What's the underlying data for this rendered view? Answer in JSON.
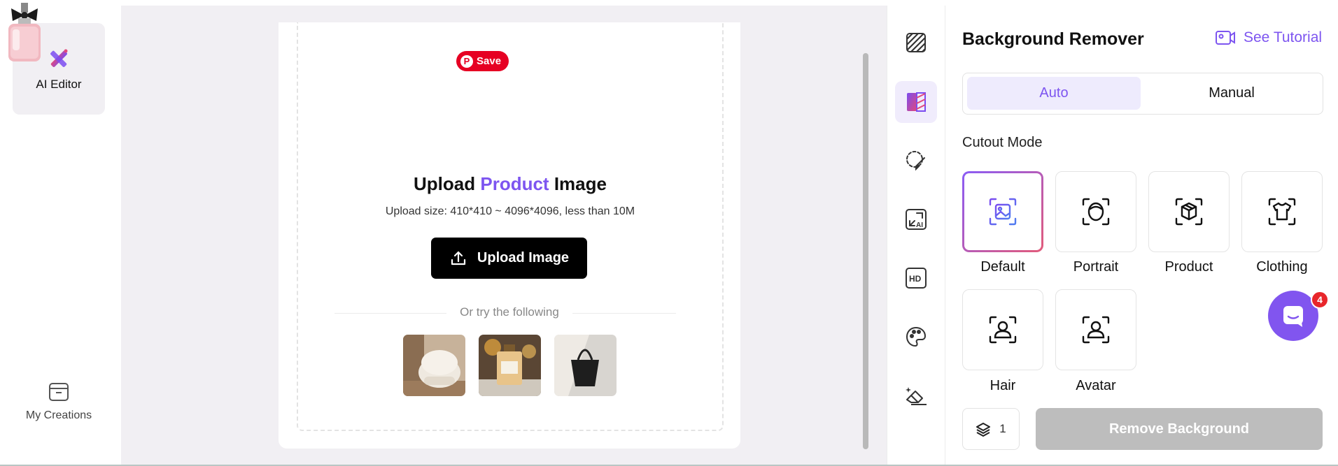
{
  "left_nav": {
    "ai_editor_label": "AI Editor",
    "my_creations_label": "My Creations"
  },
  "canvas": {
    "pinterest_save": "Save",
    "title_part1": "Upload ",
    "title_highlight": "Product",
    "title_part2": " Image",
    "upload_size": "Upload size: 410*410 ~ 4096*4096, less than 10M",
    "upload_button": "Upload Image",
    "try_text": "Or try the following",
    "samples": [
      "armchair",
      "perfume-bottle",
      "handbag"
    ]
  },
  "tools": [
    "transparent-bg-icon",
    "bg-remover-icon",
    "lasso-brush-icon",
    "ai-expand-icon",
    "hd-icon",
    "palette-icon",
    "eraser-icon"
  ],
  "panel": {
    "title": "Background Remover",
    "tutorial": "See Tutorial",
    "mode_auto": "Auto",
    "mode_manual": "Manual",
    "cutout_label": "Cutout Mode",
    "options": {
      "default": "Default",
      "portrait": "Portrait",
      "product": "Product",
      "clothing": "Clothing",
      "hair": "Hair",
      "avatar": "Avatar"
    },
    "layer_count": "1",
    "remove_button": "Remove Background"
  },
  "chat": {
    "badge": "4"
  },
  "colors": {
    "accent": "#7d55f0",
    "accent_alt": "#e44d5a",
    "chat": "#8155ef"
  }
}
